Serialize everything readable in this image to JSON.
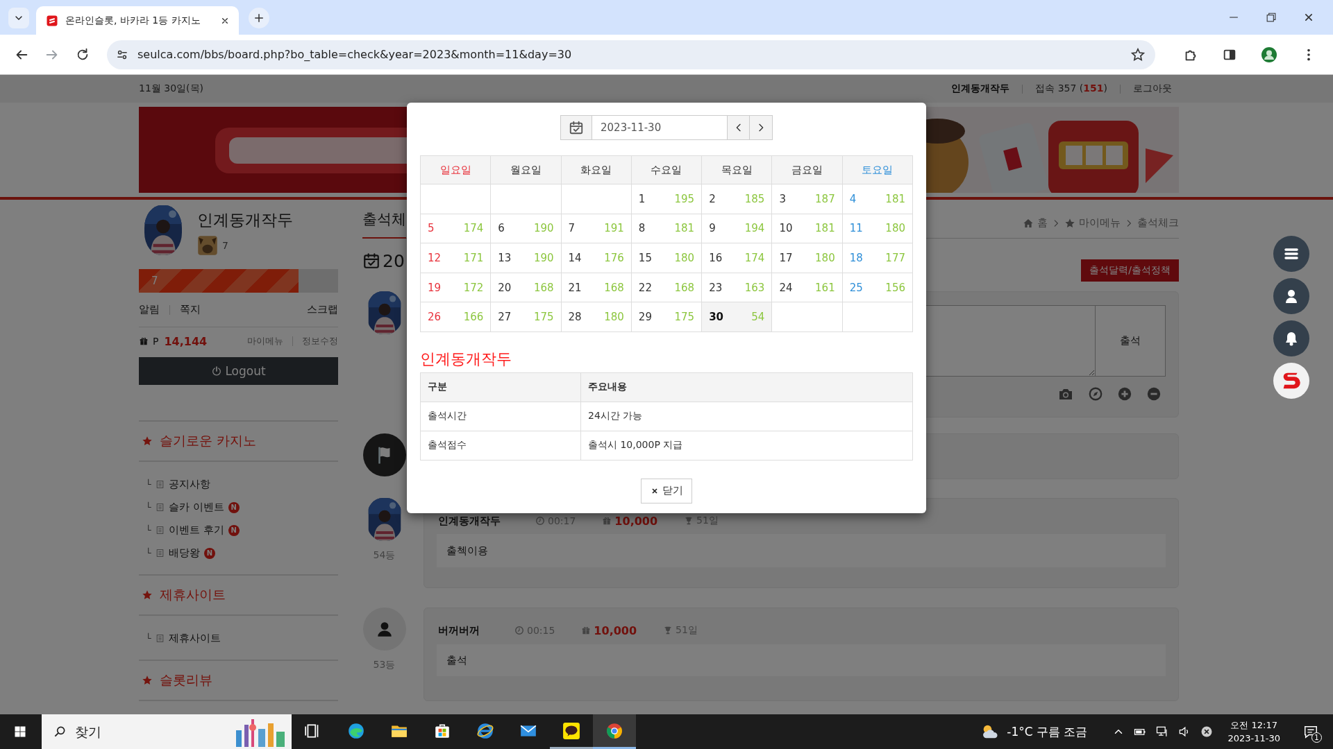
{
  "browser": {
    "tab_title": "온라인슬롯, 바카라 1등 카지노",
    "url": "seulca.com/bbs/board.php?bo_table=check&year=2023&month=11&day=30"
  },
  "topbar": {
    "date": "11월 30일(목)",
    "user": "인계동개작두",
    "visits": "접속 357 (",
    "visits_today": "151",
    "visits_end": ")",
    "logout": "로그아웃"
  },
  "profile": {
    "name": "인계동개작두",
    "level": "7",
    "exp": {
      "label": "7",
      "level": 0.8
    },
    "links": [
      "알림",
      "쪽지"
    ],
    "scrap": "스크랩",
    "points_label": "P",
    "points": "14,144",
    "account_links": [
      "마이메뉴",
      "정보수정"
    ],
    "logout": "Logout"
  },
  "menu": [
    {
      "title": "슬기로운 카지노",
      "items": [
        {
          "branch": "└",
          "label": "공지사항"
        },
        {
          "branch": "└",
          "label": "슬카 이벤트",
          "badge": "N"
        },
        {
          "branch": "└",
          "label": "이벤트 후기",
          "badge": "N"
        },
        {
          "branch": "└",
          "label": "배당왕",
          "badge": "N"
        }
      ]
    },
    {
      "title": "제휴사이트",
      "items": [
        {
          "branch": "└",
          "label": "제휴사이트"
        }
      ]
    },
    {
      "title": "슬롯리뷰"
    }
  ],
  "board": {
    "title": "출석체",
    "date_heading": "20",
    "breadcrumb": [
      "홈",
      "마이메뉴",
      "출석체크"
    ],
    "policy_button": "출석달력/출석정책",
    "submit_button": "출석",
    "entries": [
      {
        "kind": "flag"
      },
      {
        "rank": "54등",
        "name": "인계동개작두",
        "time": "00:17",
        "points": "10,000",
        "days": "51일",
        "comment": "출첵이용"
      },
      {
        "kind": "default",
        "rank": "53등",
        "name": "버꺼버꺼",
        "time": "00:15",
        "points": "10,000",
        "days": "51일",
        "comment": "출석"
      }
    ]
  },
  "modal": {
    "date": "2023-11-30",
    "weekdays": [
      {
        "label": "일요일",
        "kind": "sunday"
      },
      {
        "label": "월요일",
        "kind": "weekday"
      },
      {
        "label": "화요일",
        "kind": "weekday"
      },
      {
        "label": "수요일",
        "kind": "weekday"
      },
      {
        "label": "목요일",
        "kind": "weekday"
      },
      {
        "label": "금요일",
        "kind": "weekday"
      },
      {
        "label": "토요일",
        "kind": "saturday"
      }
    ],
    "weeks": [
      [
        {
          "kind": "blank"
        },
        {
          "kind": "blank"
        },
        {
          "kind": "blank"
        },
        {
          "kind": "day",
          "day": "1",
          "count": "195",
          "selected": false
        },
        {
          "kind": "day",
          "day": "2",
          "count": "185",
          "selected": false
        },
        {
          "kind": "day",
          "day": "3",
          "count": "187",
          "selected": false
        },
        {
          "kind": "day",
          "day": "4",
          "count": "181",
          "selected": false
        }
      ],
      [
        {
          "kind": "day",
          "day": "5",
          "count": "174",
          "selected": false
        },
        {
          "kind": "day",
          "day": "6",
          "count": "190",
          "selected": false
        },
        {
          "kind": "day",
          "day": "7",
          "count": "191",
          "selected": false
        },
        {
          "kind": "day",
          "day": "8",
          "count": "181",
          "selected": false
        },
        {
          "kind": "day",
          "day": "9",
          "count": "194",
          "selected": false
        },
        {
          "kind": "day",
          "day": "10",
          "count": "181",
          "selected": false
        },
        {
          "kind": "day",
          "day": "11",
          "count": "180",
          "selected": false
        }
      ],
      [
        {
          "kind": "day",
          "day": "12",
          "count": "171",
          "selected": false
        },
        {
          "kind": "day",
          "day": "13",
          "count": "190",
          "selected": false
        },
        {
          "kind": "day",
          "day": "14",
          "count": "176",
          "selected": false
        },
        {
          "kind": "day",
          "day": "15",
          "count": "180",
          "selected": false
        },
        {
          "kind": "day",
          "day": "16",
          "count": "174",
          "selected": false
        },
        {
          "kind": "day",
          "day": "17",
          "count": "180",
          "selected": false
        },
        {
          "kind": "day",
          "day": "18",
          "count": "177",
          "selected": false
        }
      ],
      [
        {
          "kind": "day",
          "day": "19",
          "count": "172",
          "selected": false
        },
        {
          "kind": "day",
          "day": "20",
          "count": "168",
          "selected": false
        },
        {
          "kind": "day",
          "day": "21",
          "count": "168",
          "selected": false
        },
        {
          "kind": "day",
          "day": "22",
          "count": "168",
          "selected": false
        },
        {
          "kind": "day",
          "day": "23",
          "count": "163",
          "selected": false
        },
        {
          "kind": "day",
          "day": "24",
          "count": "161",
          "selected": false
        },
        {
          "kind": "day",
          "day": "25",
          "count": "156",
          "selected": false
        }
      ],
      [
        {
          "kind": "day",
          "day": "26",
          "count": "166",
          "selected": false
        },
        {
          "kind": "day",
          "day": "27",
          "count": "175",
          "selected": false
        },
        {
          "kind": "day",
          "day": "28",
          "count": "180",
          "selected": false
        },
        {
          "kind": "day",
          "day": "29",
          "count": "175",
          "selected": false
        },
        {
          "kind": "day",
          "day": "30",
          "count": "54",
          "selected": true
        },
        {
          "kind": "blank"
        },
        {
          "kind": "blank"
        }
      ]
    ],
    "section_title": "인계동개작두",
    "info_table": {
      "columns": [
        "구분",
        "주요내용"
      ],
      "rows": [
        [
          "출석시간",
          "24시간 가능"
        ],
        [
          "출석점수",
          "출석시 10,000P 지급"
        ]
      ]
    },
    "close_button": "닫기"
  },
  "taskbar": {
    "search_placeholder": "찾기",
    "apps": [
      {
        "kind": "taskview",
        "running": false,
        "selected": false
      },
      {
        "kind": "edge",
        "running": false,
        "selected": false
      },
      {
        "kind": "explorer",
        "running": false,
        "selected": false
      },
      {
        "kind": "store",
        "running": false,
        "selected": false
      },
      {
        "kind": "ie",
        "running": false,
        "selected": false
      },
      {
        "kind": "mail",
        "running": false,
        "selected": false
      },
      {
        "kind": "kakao",
        "running": true,
        "selected": false
      },
      {
        "kind": "chrome",
        "running": true,
        "selected": true
      }
    ],
    "weather": "-1°C 구름 조금",
    "time": "오전 12:17",
    "date": "2023-11-30",
    "notifications": "1"
  }
}
